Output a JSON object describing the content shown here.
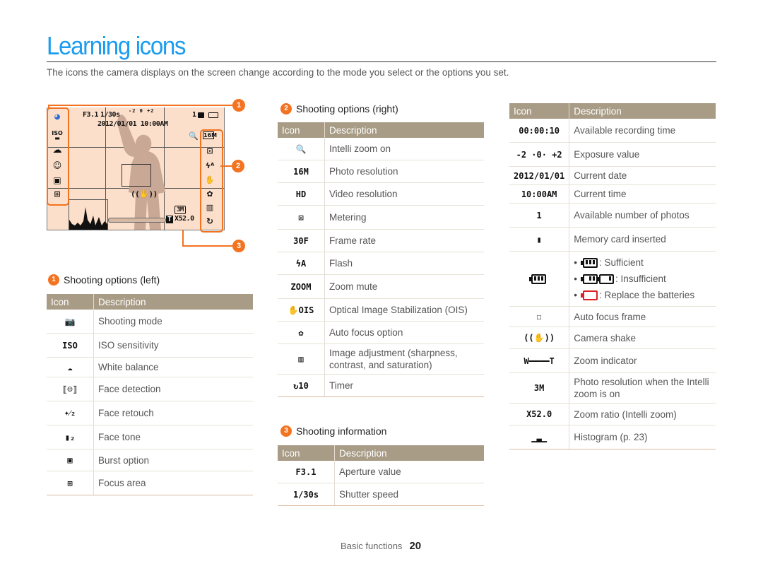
{
  "header": {
    "title": "Learning icons",
    "intro": "The icons the camera displays on the screen change according to the mode you select or the options you set."
  },
  "preview": {
    "aperture": "F3.1",
    "shutter": "1/30s",
    "ev_scale": "-2 0 +2",
    "date_time": "2012/01/01  10:00AM",
    "photos_count": "1",
    "intelli_res": "3M",
    "zoom_ratio": "X52.0",
    "callouts": [
      "1",
      "2",
      "3"
    ],
    "accent_color": "#f37321",
    "background_color": "#fbdfca"
  },
  "columns": {
    "icon": "Icon",
    "description": "Description"
  },
  "sections": {
    "left": {
      "number": "1",
      "title": "Shooting options (left)",
      "rows": [
        {
          "icon": "camera-mode-icon",
          "glyph": "📷",
          "description": "Shooting mode"
        },
        {
          "icon": "iso-icon",
          "glyph": "ISO",
          "description": "ISO sensitivity"
        },
        {
          "icon": "cloud-icon",
          "glyph": "☁",
          "description": "White balance"
        },
        {
          "icon": "face-detection-icon",
          "glyph": "⟦☺⟧",
          "description": "Face detection"
        },
        {
          "icon": "face-retouch-icon",
          "glyph": "✦⁄₂",
          "description": "Face retouch"
        },
        {
          "icon": "face-tone-icon",
          "glyph": "▮₂",
          "description": "Face tone"
        },
        {
          "icon": "burst-icon",
          "glyph": "▣",
          "description": "Burst option"
        },
        {
          "icon": "focus-area-icon",
          "glyph": "⊞",
          "description": "Focus area"
        }
      ]
    },
    "right": {
      "number": "2",
      "title": "Shooting options (right)",
      "rows": [
        {
          "icon": "intelli-zoom-icon",
          "glyph": "🔍",
          "description": "Intelli zoom on"
        },
        {
          "icon": "photo-resolution-icon",
          "glyph": "16M",
          "description": "Photo resolution"
        },
        {
          "icon": "video-resolution-icon",
          "glyph": "HD",
          "description": "Video resolution"
        },
        {
          "icon": "metering-icon",
          "glyph": "⊡",
          "description": "Metering"
        },
        {
          "icon": "frame-rate-icon",
          "glyph": "30F",
          "description": "Frame rate"
        },
        {
          "icon": "flash-icon",
          "glyph": "ϟA",
          "description": "Flash"
        },
        {
          "icon": "zoom-mute-icon",
          "glyph": "ZOOM",
          "description": "Zoom mute"
        },
        {
          "icon": "ois-icon",
          "glyph": "✋OIS",
          "description": "Optical Image Stabilization (OIS)"
        },
        {
          "icon": "auto-focus-icon",
          "glyph": "✿",
          "description": "Auto focus option"
        },
        {
          "icon": "image-adjust-icon",
          "glyph": "▥",
          "description": "Image adjustment (sharpness, contrast, and saturation)"
        },
        {
          "icon": "timer-icon",
          "glyph": "↻10",
          "description": "Timer"
        }
      ]
    },
    "info": {
      "number": "3",
      "title": "Shooting information",
      "rows": [
        {
          "icon": "aperture-value-icon",
          "glyph": "F3.1",
          "description": "Aperture value"
        },
        {
          "icon": "shutter-speed-icon",
          "glyph": "1/30s",
          "description": "Shutter speed"
        }
      ],
      "rows_continued": [
        {
          "icon": "recording-time-icon",
          "glyph": "00:00:10",
          "description": "Available recording time"
        },
        {
          "icon": "exposure-value-icon",
          "glyph": "-2 ·0· +2",
          "description": "Exposure value"
        },
        {
          "icon": "current-date-icon",
          "glyph": "2012/01/01",
          "description": "Current date"
        },
        {
          "icon": "current-time-icon",
          "glyph": "10:00AM",
          "description": "Current time"
        },
        {
          "icon": "photos-count-icon",
          "glyph": "1",
          "description": "Available number of photos"
        },
        {
          "icon": "memory-card-icon",
          "glyph": "▮",
          "description": "Memory card inserted"
        },
        {
          "icon": "battery-icon",
          "glyph": "",
          "description": "",
          "battery": {
            "sufficient": ": Sufficient",
            "insufficient": ": Insufficient",
            "replace": ": Replace the batteries"
          }
        },
        {
          "icon": "af-frame-icon",
          "glyph": "☐",
          "description": "Auto focus frame"
        },
        {
          "icon": "camera-shake-icon",
          "glyph": "((✋))",
          "description": "Camera shake"
        },
        {
          "icon": "zoom-indicator-icon",
          "glyph": "W━━━━T",
          "description": "Zoom indicator"
        },
        {
          "icon": "intelli-resolution-icon",
          "glyph": "3M",
          "description": "Photo resolution when the Intelli zoom is on"
        },
        {
          "icon": "zoom-ratio-icon",
          "glyph": "X52.0",
          "description": "Zoom ratio (Intelli zoom)"
        },
        {
          "icon": "histogram-icon",
          "glyph": "▁▃▁",
          "description": "Histogram (p. 23)"
        }
      ]
    }
  },
  "footer": {
    "section": "Basic functions",
    "page": "20"
  }
}
